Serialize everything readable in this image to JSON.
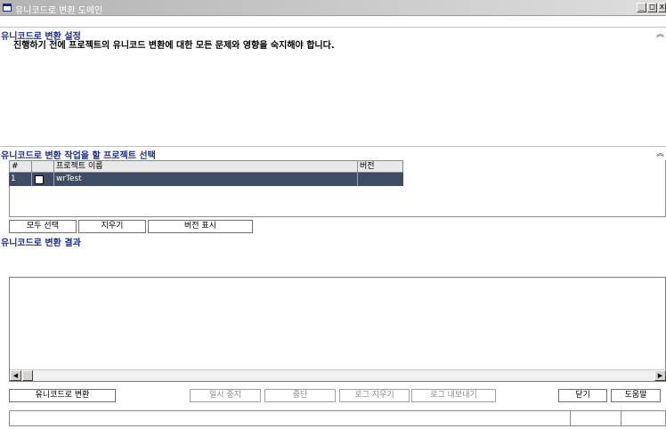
{
  "window": {
    "title": "유니코드로 변환 도메인",
    "controls": {
      "minimize": "_",
      "maximize": "□",
      "close": "x"
    }
  },
  "settings_section": {
    "title": "유니코드로 변환 설정",
    "collapse_icon": "chevron-up-icon",
    "description": "진행하기 전에 프로젝트의 유니코드 변환에 대한 모든 문제와 영향을 숙지해야 합니다."
  },
  "project_section": {
    "title": "유니코드로 변환 작업을 할 프로젝트 선택",
    "collapse_icon": "chevron-up-icon",
    "columns": [
      "#",
      "",
      "프로젝트 이름",
      "버전"
    ],
    "rows": [
      {
        "num": "1",
        "checked": false,
        "name": "wrTest",
        "version": ""
      }
    ],
    "buttons": {
      "select_all": "모두 선택",
      "clear": "지우기",
      "show_version": "버전 표시"
    }
  },
  "results_section": {
    "title": "유니코드로 변환 결과"
  },
  "footer": {
    "convert": "유니코드로 변환",
    "pause": "일시 중지",
    "stop": "중단",
    "clear_log": "로그 지우기",
    "export_log": "로그 내보내기",
    "close": "닫기",
    "help": "도움말"
  },
  "colors": {
    "section_title": "#1f2f86",
    "selected_row": "#3e4d63"
  }
}
